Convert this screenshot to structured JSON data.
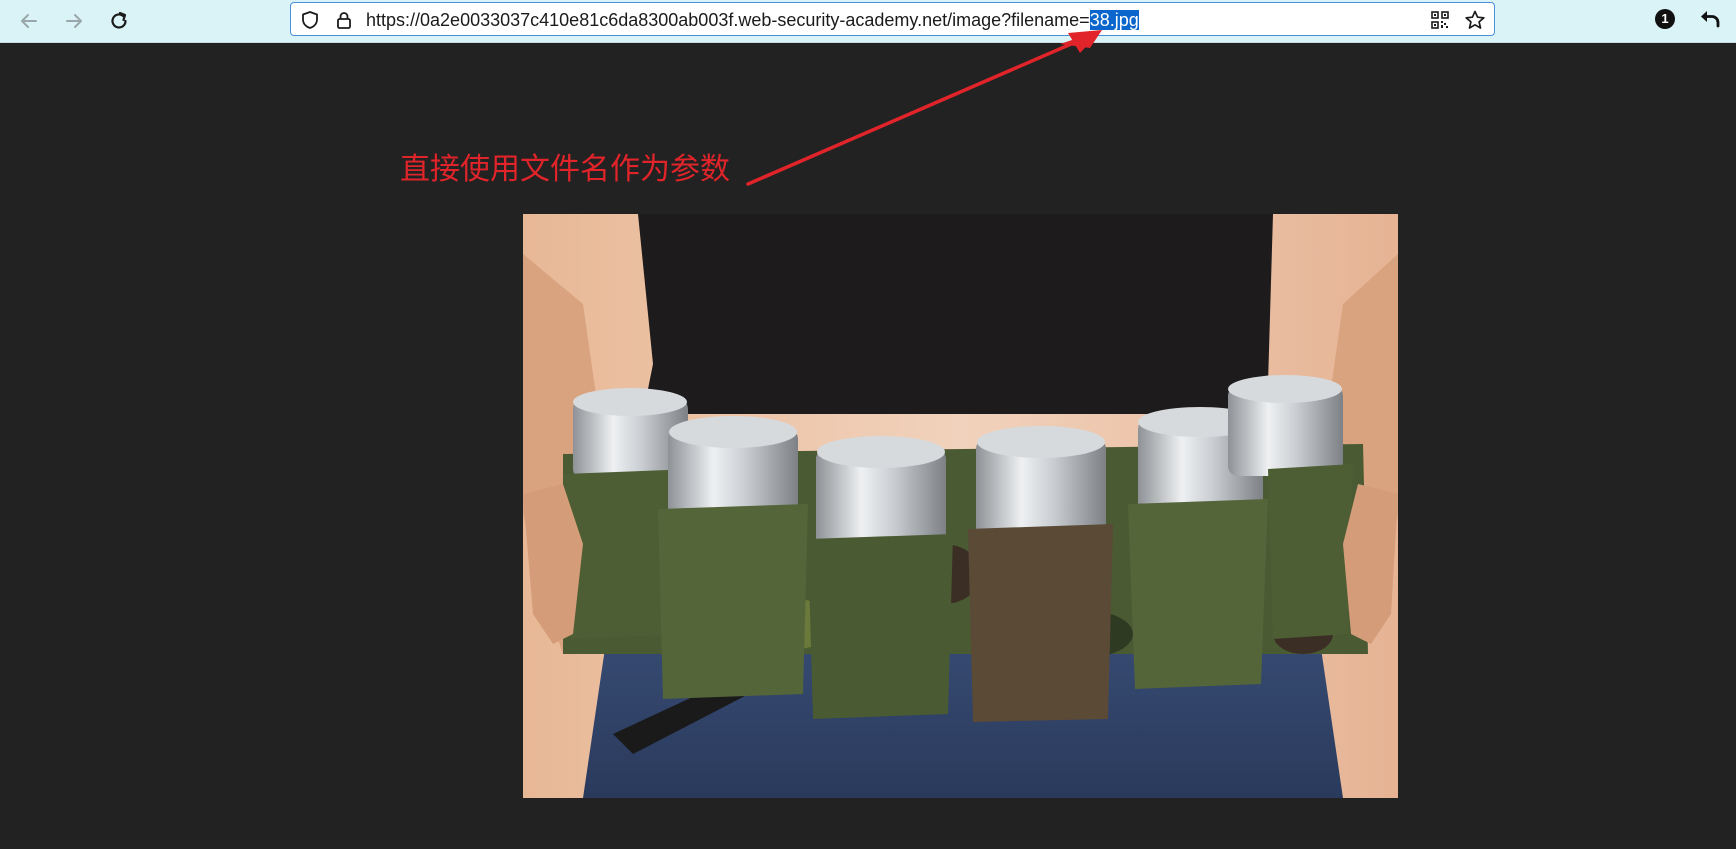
{
  "browser": {
    "url_base": "https://0a2e0033037c410e81c6da8300ab003f.web-security-academy.net/image?filename=",
    "url_selected": "38.jpg",
    "icons": {
      "back": "arrow-left-icon",
      "forward": "arrow-right-icon",
      "reload": "reload-icon",
      "shield": "shield-icon",
      "lock": "lock-icon",
      "qr": "qr-code-icon",
      "bookmark": "star-icon",
      "extension_badge": "1",
      "undo": "undo-arrow-icon"
    },
    "colors": {
      "toolbar_bg": "#d9f3f6",
      "selection": "#0a66cc"
    }
  },
  "annotation": {
    "text": "直接使用文件名作为参数",
    "color": "#e0242a"
  },
  "image": {
    "description": "product-photo-beer-can-belt"
  }
}
